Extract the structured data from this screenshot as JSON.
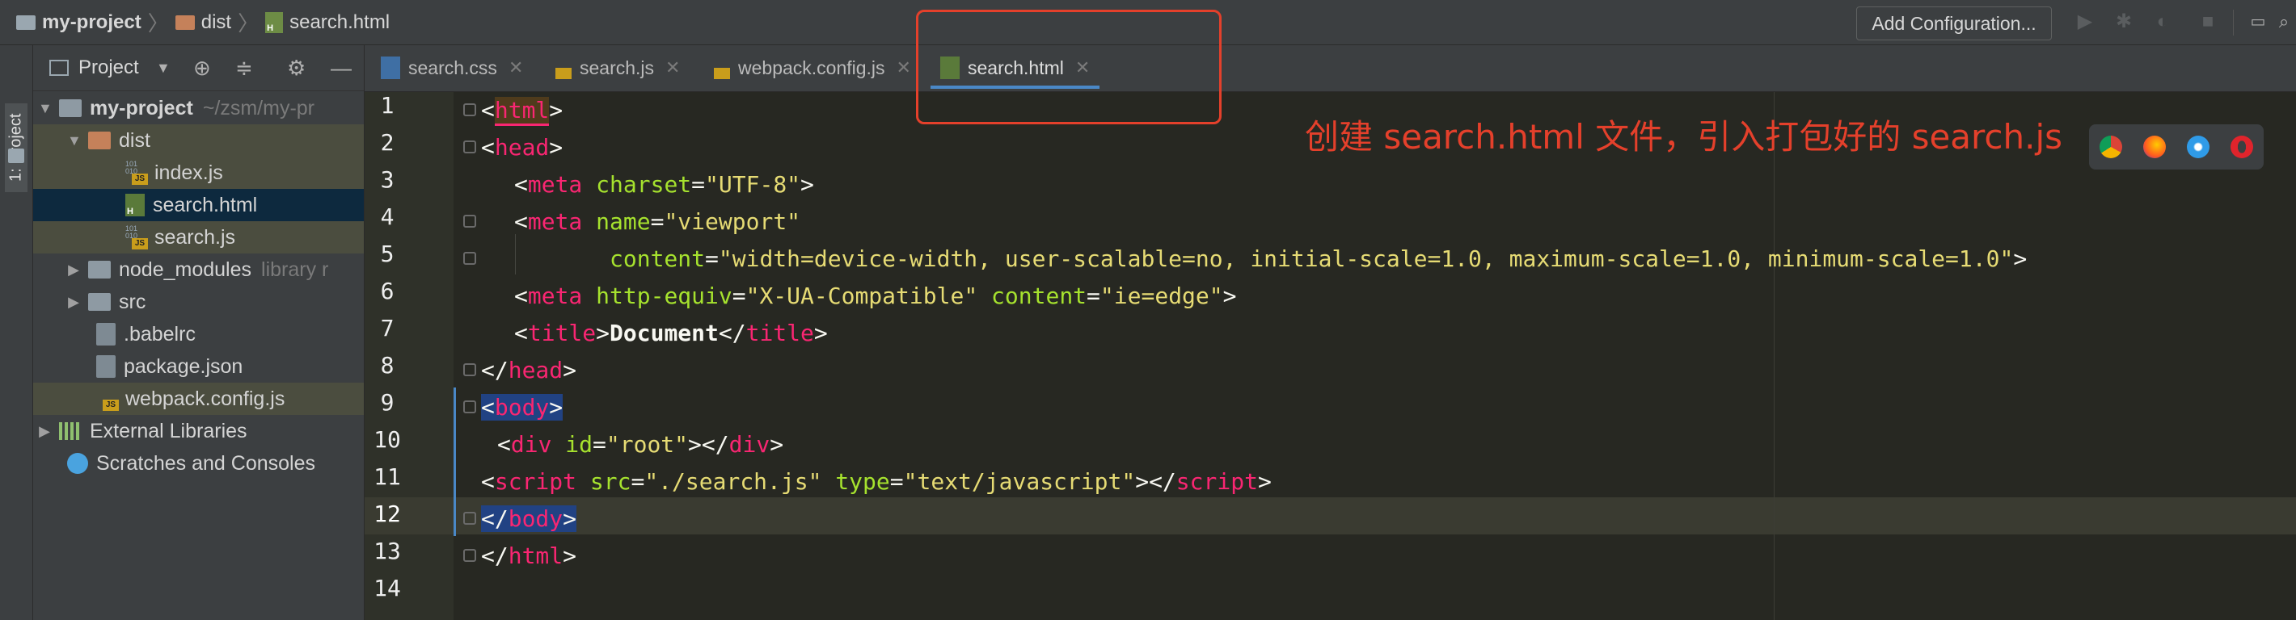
{
  "navbar": {
    "breadcrumbs": [
      "my-project",
      "dist",
      "search.html"
    ],
    "add_config_label": "Add Configuration..."
  },
  "stripe": {
    "project_label": "1: Project"
  },
  "project_panel": {
    "title": "Project",
    "tree": [
      {
        "label": "my-project",
        "extra": "~/zsm/my-pr",
        "type": "folder"
      },
      {
        "label": "dist",
        "type": "folder"
      },
      {
        "label": "index.js",
        "type": "js"
      },
      {
        "label": "search.html",
        "type": "html"
      },
      {
        "label": "search.js",
        "type": "js"
      },
      {
        "label": "node_modules",
        "extra": "library r",
        "type": "folder"
      },
      {
        "label": "src",
        "type": "folder"
      },
      {
        "label": ".babelrc",
        "type": "config"
      },
      {
        "label": "package.json",
        "type": "config"
      },
      {
        "label": "webpack.config.js",
        "type": "js"
      },
      {
        "label": "External Libraries",
        "type": "library"
      },
      {
        "label": "Scratches and Consoles",
        "type": "scratch"
      }
    ]
  },
  "tabs": [
    {
      "label": "search.css",
      "icon": "css-file-icon"
    },
    {
      "label": "search.js",
      "icon": "js-file-icon"
    },
    {
      "label": "webpack.config.js",
      "icon": "js-file-icon"
    },
    {
      "label": "search.html",
      "icon": "html-file-icon",
      "active": true
    }
  ],
  "line_numbers": [
    "1",
    "2",
    "3",
    "4",
    "5",
    "6",
    "7",
    "8",
    "9",
    "10",
    "11",
    "12",
    "13",
    "14"
  ],
  "code": {
    "l1": {
      "lt": "<",
      "tag": "html",
      "gt": ">"
    },
    "l2": {
      "lt": "<",
      "tag": "head",
      "gt": ">"
    },
    "l3": {
      "lt": "<",
      "tag": "meta",
      "a1": "charset",
      "eq": "=",
      "v1": "\"UTF-8\"",
      "gt": ">"
    },
    "l4": {
      "lt": "<",
      "tag": "meta",
      "a1": "name",
      "eq": "=",
      "v1": "\"viewport\""
    },
    "l5": {
      "a1": "content",
      "eq": "=",
      "v1": "\"width=device-width, user-scalable=no, initial-scale=1.0, maximum-scale=1.0, minimum-scale=1.0\"",
      "gt": ">"
    },
    "l6": {
      "lt": "<",
      "tag": "meta",
      "a1": "http-equiv",
      "eq": "=",
      "v1": "\"X-UA-Compatible\"",
      "a2": "content",
      "v2": "\"ie=edge\"",
      "gt": ">"
    },
    "l7": {
      "lt": "<",
      "tag": "title",
      "gt": ">",
      "text": "Document",
      "lt2": "</",
      "tag2": "title",
      "gt2": ">"
    },
    "l8": {
      "lt": "</",
      "tag": "head",
      "gt": ">"
    },
    "l9": {
      "lt": "<",
      "tag": "body",
      "gt": ">"
    },
    "l10": {
      "lt": "<",
      "tag": "div",
      "a1": "id",
      "eq": "=",
      "v1": "\"root\"",
      "gt": ">",
      "lt2": "</",
      "tag2": "div",
      "gt2": ">"
    },
    "l11": {
      "lt": "<",
      "tag": "script",
      "a1": "src",
      "eq": "=",
      "v1": "\"./search.js\"",
      "a2": "type",
      "v2": "\"text/javascript\"",
      "gt": ">",
      "lt2": "</",
      "tag2": "script",
      "gt2": ">"
    },
    "l12": {
      "lt": "</",
      "tag": "body",
      "gt": ">"
    },
    "l13": {
      "lt": "</",
      "tag": "html",
      "gt": ">"
    }
  },
  "annotation": "创建 search.html 文件，引入打包好的 search.js",
  "browsers": [
    "chrome-icon",
    "firefox-icon",
    "safari-icon",
    "opera-icon"
  ],
  "colors": {
    "highlight_red": "#e4402b",
    "tag": "#f92672",
    "attr": "#a6e22e",
    "string": "#e6db74",
    "selection": "#214283"
  }
}
